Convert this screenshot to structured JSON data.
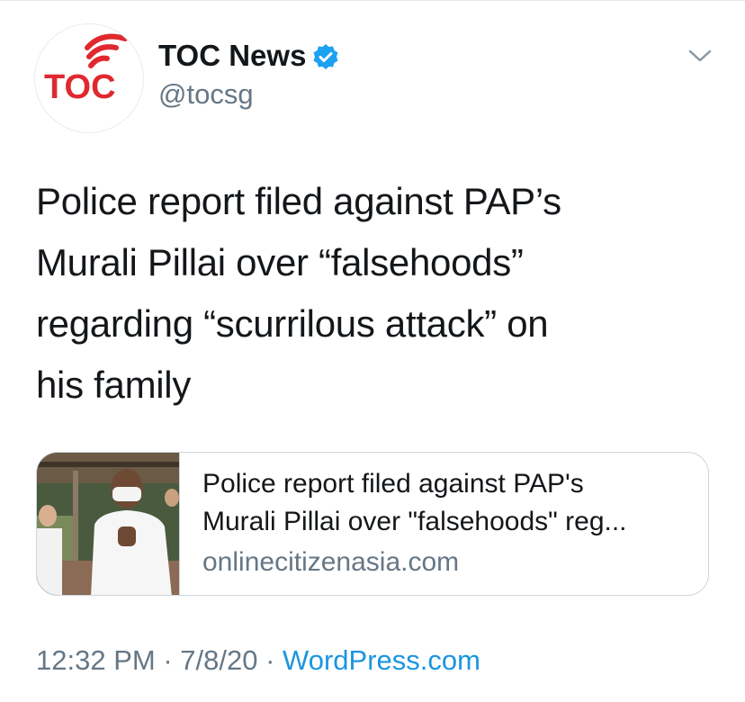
{
  "author": {
    "name": "TOC News",
    "handle": "@tocsg",
    "verified": true,
    "avatar_text": "TOC",
    "avatar_color": "#e0292f"
  },
  "tweet": {
    "text_lines": [
      "Police report filed against PAP’s",
      "Murali Pillai over “falsehoods”",
      "regarding “scurrilous attack” on",
      "his family"
    ]
  },
  "card": {
    "title_lines": [
      "Police report filed against PAP's",
      "Murali Pillai over \"falsehoods\" reg..."
    ],
    "domain": "onlinecitizenasia.com"
  },
  "meta": {
    "time": "12:32 PM",
    "date": "7/8/20",
    "separator": " · ",
    "source": "WordPress.com"
  },
  "colors": {
    "text": "#14171a",
    "secondary": "#657786",
    "link": "#1b95e0",
    "verified": "#1da1f2",
    "border": "#ccd6dd"
  }
}
